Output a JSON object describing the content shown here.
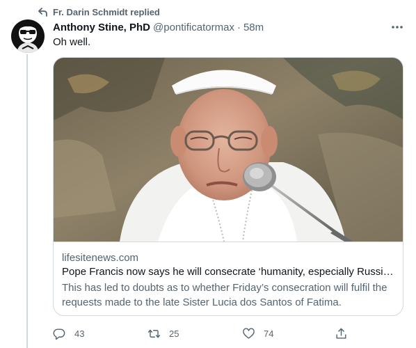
{
  "social_context": {
    "text": "Fr. Darin Schmidt replied",
    "icon": "reply-arrow-icon"
  },
  "tweet": {
    "display_name": "Anthony Stine, PhD",
    "handle": "@pontificatormax",
    "separator": "·",
    "time": "58m",
    "text": "Oh well.",
    "more_icon": "more-dots-icon"
  },
  "card": {
    "domain": "lifesitenews.com",
    "title": "Pope Francis now says he will consecrate ‘humanity, especially Russia...",
    "description": "This has led to doubts as to whether Friday’s consecration will fulfil the requests made to the late Sister Lucia dos Santos of Fatima.",
    "image_alt": "photo of Pope Francis speaking into a microphone"
  },
  "actions": {
    "reply": {
      "icon": "reply-icon",
      "count": "43"
    },
    "retweet": {
      "icon": "retweet-icon",
      "count": "25"
    },
    "like": {
      "icon": "heart-icon",
      "count": "74"
    },
    "share": {
      "icon": "share-icon"
    }
  },
  "colors": {
    "primary_text": "#0f1419",
    "secondary_text": "#536471",
    "border": "#cfd9de",
    "background": "#ffffff"
  }
}
